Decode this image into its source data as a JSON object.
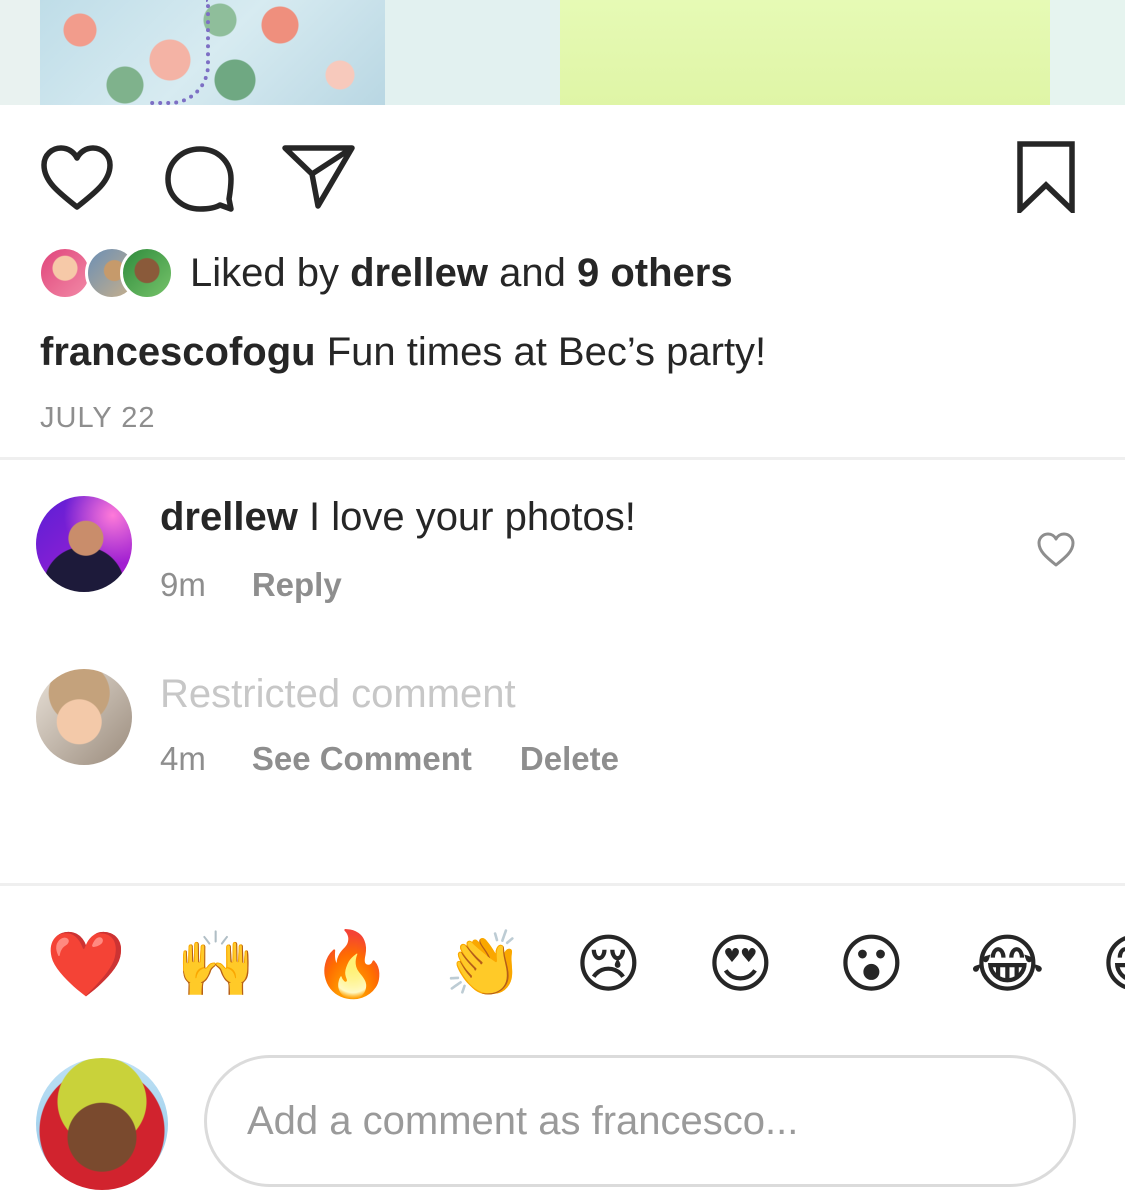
{
  "post": {
    "liked_by_prefix": "Liked by",
    "liked_by_user": "drellew",
    "liked_by_and": "and",
    "liked_by_others": "9 others",
    "caption_user": "francescofogu",
    "caption_text": "Fun times at Bec’s party!",
    "date": "JULY 22"
  },
  "action_icons": [
    "heart-icon",
    "comment-icon",
    "share-icon",
    "bookmark-icon"
  ],
  "comments": [
    {
      "user": "drellew",
      "text": "I love your photos!",
      "time": "9m",
      "actions": [
        "Reply"
      ]
    },
    {
      "text": "Restricted comment",
      "time": "4m",
      "actions": [
        "See Comment",
        "Delete"
      ]
    }
  ],
  "emoji_reactions": [
    "❤️",
    "🙌",
    "🔥",
    "👏",
    "😢",
    "😍",
    "😮",
    "😂",
    "😄"
  ],
  "comment_input": {
    "placeholder": "Add a comment as francesco..."
  },
  "colors": {
    "text": "#262626",
    "secondary": "#8e8e8e",
    "restricted": "#c7c7c7",
    "divider": "#efefef"
  }
}
